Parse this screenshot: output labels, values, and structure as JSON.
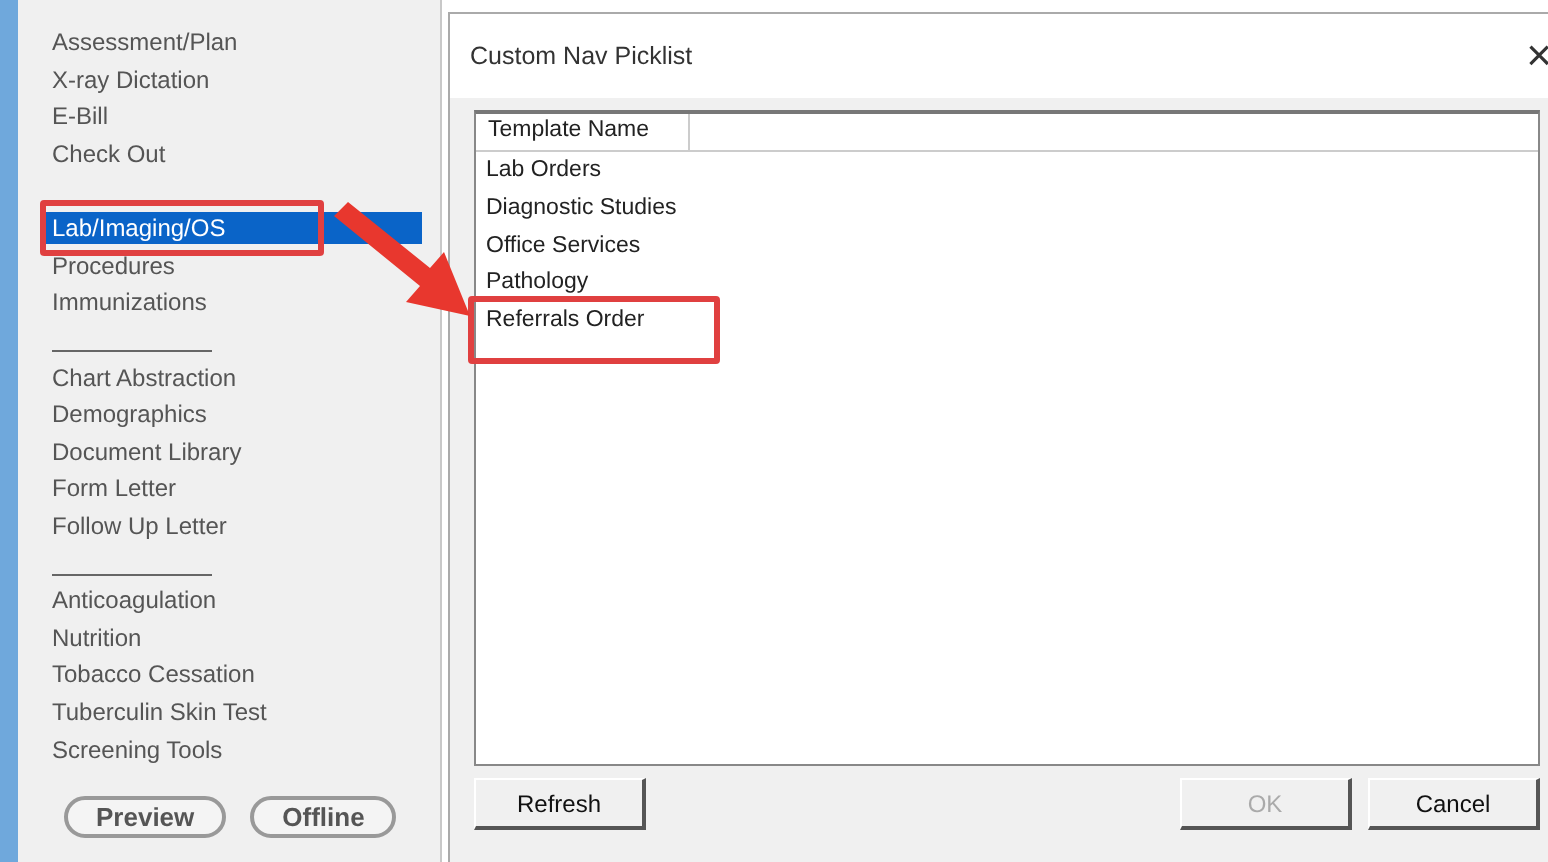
{
  "sidebar": {
    "items": [
      {
        "kind": "item",
        "label": "Assessment/Plan",
        "selected": false
      },
      {
        "kind": "item",
        "label": "X-ray Dictation",
        "selected": false
      },
      {
        "kind": "item",
        "label": "E-Bill",
        "selected": false
      },
      {
        "kind": "item",
        "label": "Check Out",
        "selected": false
      },
      {
        "kind": "separator"
      },
      {
        "kind": "item",
        "label": "Lab/Imaging/OS",
        "selected": true,
        "callout": true
      },
      {
        "kind": "item",
        "label": "Procedures",
        "selected": false
      },
      {
        "kind": "item",
        "label": "Immunizations",
        "selected": false
      },
      {
        "kind": "separator"
      },
      {
        "kind": "item",
        "label": "Chart Abstraction",
        "selected": false
      },
      {
        "kind": "item",
        "label": "Demographics",
        "selected": false
      },
      {
        "kind": "item",
        "label": "Document Library",
        "selected": false
      },
      {
        "kind": "item",
        "label": "Form Letter",
        "selected": false
      },
      {
        "kind": "item",
        "label": "Follow Up Letter",
        "selected": false
      },
      {
        "kind": "separator"
      },
      {
        "kind": "item",
        "label": "Anticoagulation",
        "selected": false
      },
      {
        "kind": "item",
        "label": "Nutrition",
        "selected": false
      },
      {
        "kind": "item",
        "label": "Tobacco Cessation",
        "selected": false
      },
      {
        "kind": "item",
        "label": "Tuberculin Skin Test",
        "selected": false
      },
      {
        "kind": "item",
        "label": "Screening Tools",
        "selected": false
      }
    ],
    "buttons": [
      "Preview",
      "Offline"
    ]
  },
  "dialog": {
    "title": "Custom Nav Picklist",
    "close": "×",
    "column": "Template Name",
    "rows": [
      {
        "label": "Lab Orders",
        "callout": false
      },
      {
        "label": "Diagnostic Studies",
        "callout": false
      },
      {
        "label": "Office Services",
        "callout": false
      },
      {
        "label": "Pathology",
        "callout": false
      },
      {
        "label": "Referrals Order",
        "callout": true
      }
    ],
    "buttons": [
      {
        "label": "Refresh",
        "disabled": false
      },
      {
        "label": "OK",
        "disabled": true
      },
      {
        "label": "Cancel",
        "disabled": false
      }
    ]
  }
}
